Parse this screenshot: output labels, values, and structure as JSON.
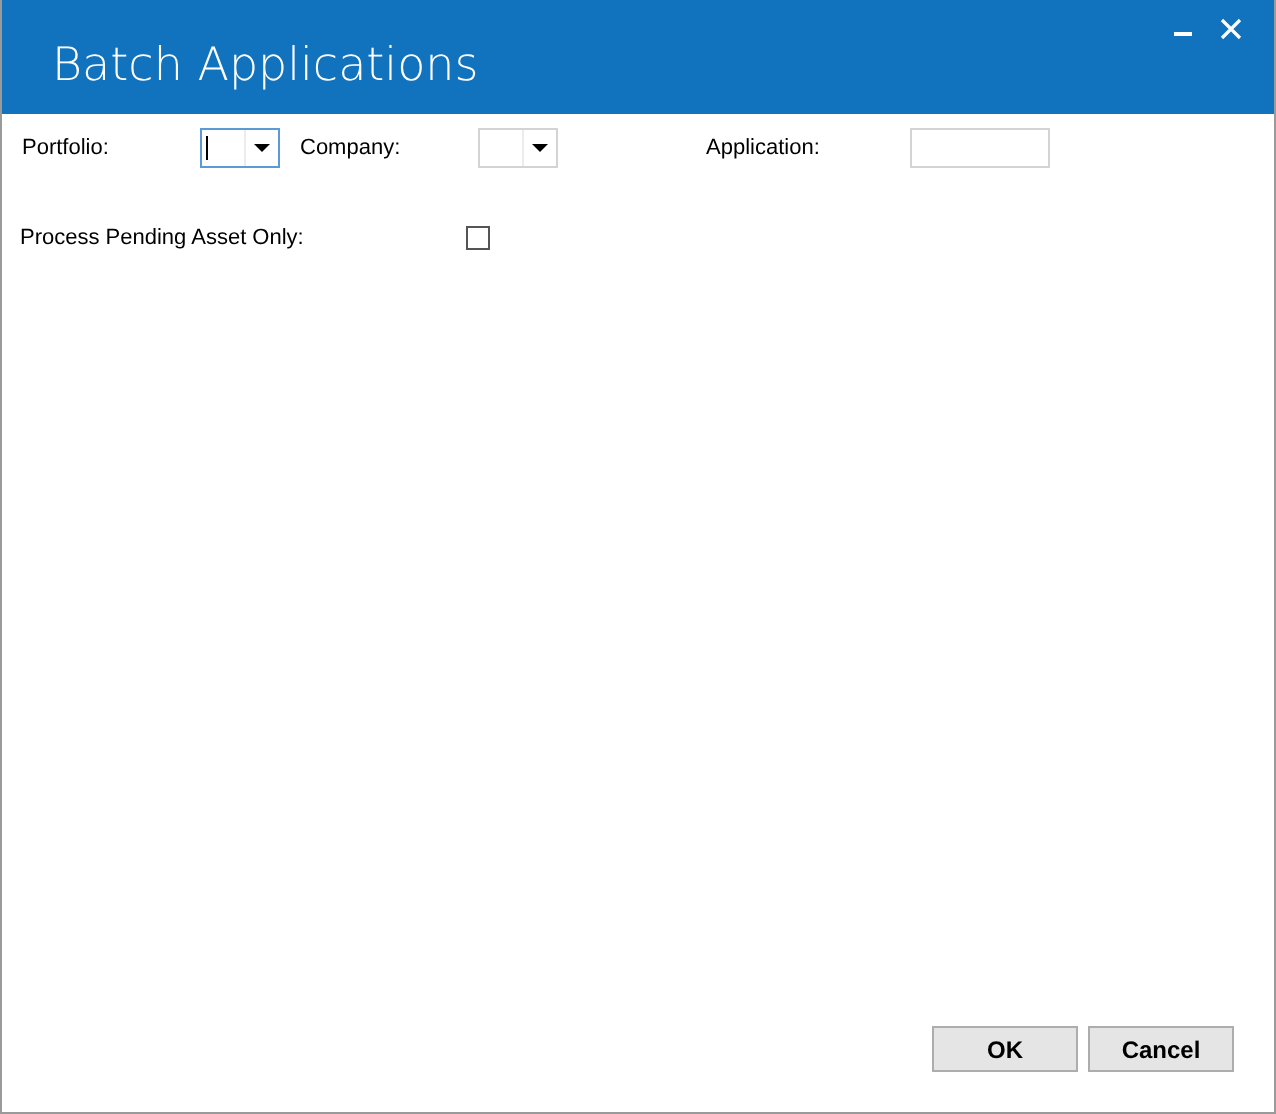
{
  "window": {
    "title": "Batch Applications"
  },
  "fields": [
    {
      "label": "Portfolio:",
      "kind": "combo",
      "focused": true
    },
    {
      "label": "Company:",
      "kind": "combo",
      "focused": false
    },
    {
      "label": "Application:",
      "kind": "text",
      "focused": false
    }
  ],
  "option": {
    "label": "Process Pending Asset Only:",
    "checked": false
  },
  "buttons": [
    "OK",
    "Cancel"
  ]
}
